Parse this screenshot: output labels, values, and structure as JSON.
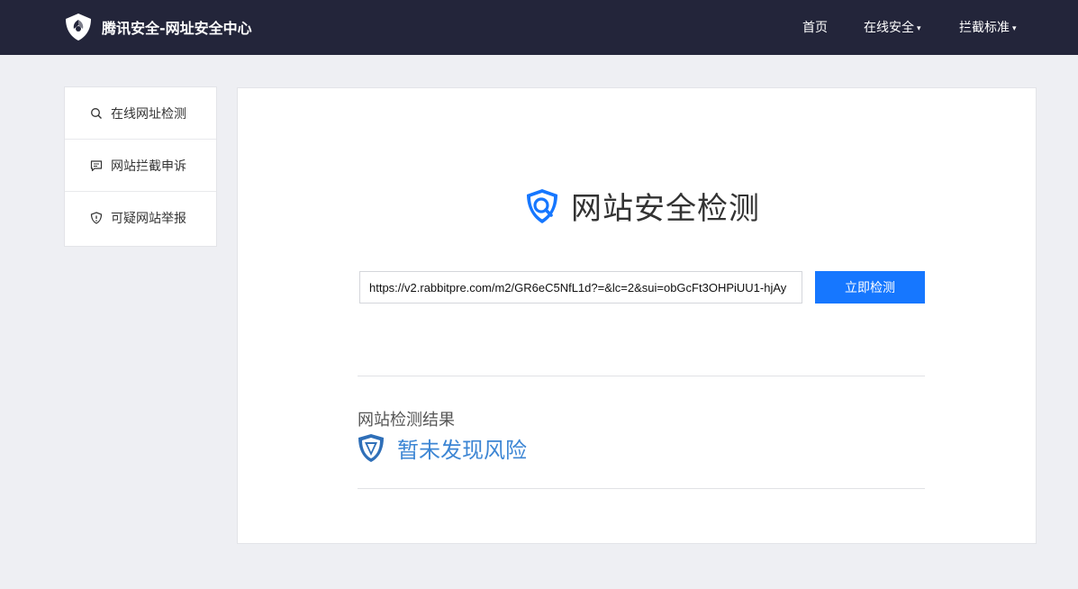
{
  "header": {
    "site_title": "腾讯安全-网址安全中心",
    "nav": [
      {
        "label": "首页"
      },
      {
        "label": "在线安全"
      },
      {
        "label": "拦截标准"
      }
    ],
    "dropdown_caret": "▾"
  },
  "sidebar": {
    "items": [
      {
        "label": "在线网址检测",
        "icon": "search-icon"
      },
      {
        "label": "网站拦截申诉",
        "icon": "chat-icon"
      },
      {
        "label": "可疑网站举报",
        "icon": "shield-alert-icon"
      }
    ]
  },
  "main": {
    "title": "网站安全检测",
    "url_value": "https://v2.rabbitpre.com/m2/GR6eC5NfL1d?=&lc=2&sui=obGcFt3OHPiUU1-hjAy",
    "check_button": "立即检测",
    "result_label": "网站检测结果",
    "result_status": "暂未发现风险"
  },
  "colors": {
    "topbar": "#23253a",
    "accent": "#1677ff",
    "result": "#3d86d4"
  }
}
